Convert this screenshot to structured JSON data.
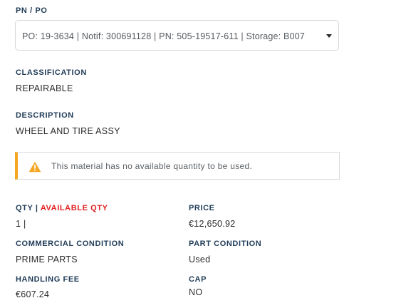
{
  "pn_po": {
    "label": "PN / PO",
    "selected": "PO: 19-3634 | Notif: 300691128 | PN: 505-19517-611 | Storage: B007"
  },
  "classification": {
    "label": "CLASSIFICATION",
    "value": "REPAIRABLE"
  },
  "description": {
    "label": "DESCRIPTION",
    "value": "WHEEL AND TIRE ASSY"
  },
  "alert": {
    "icon": "warning-icon",
    "accent_color": "#f5a623",
    "text": "This material has no available quantity to be used."
  },
  "qty": {
    "label_qty": "QTY",
    "separator": " | ",
    "label_available": "AVAILABLE QTY",
    "available_color": "#e02020",
    "value": "1 |"
  },
  "price": {
    "label": "PRICE",
    "value": "€12,650.92"
  },
  "commercial_condition": {
    "label": "COMMERCIAL CONDITION",
    "value": "PRIME PARTS"
  },
  "part_condition": {
    "label": "PART CONDITION",
    "value": "Used"
  },
  "handling_fee": {
    "label": "HANDLING FEE",
    "value": "€607.24"
  },
  "cap": {
    "label": "CAP",
    "value": "NO"
  }
}
